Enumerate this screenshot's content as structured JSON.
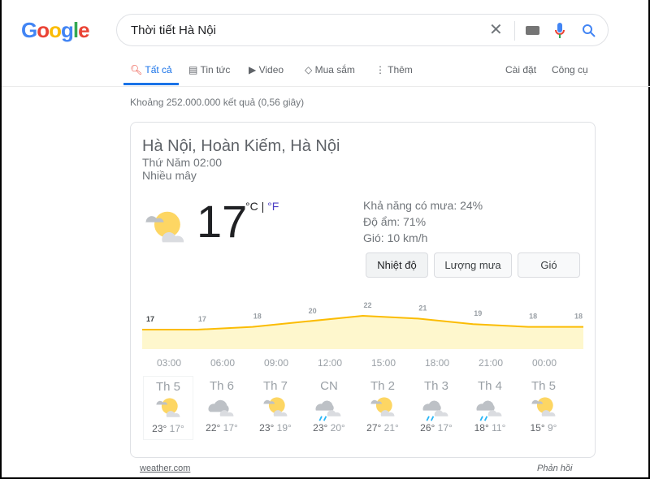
{
  "logo": "Google",
  "search": {
    "query": "Thời tiết Hà Nội"
  },
  "tabs": [
    {
      "label": "Tất cả",
      "icon": "search-icon"
    },
    {
      "label": "Tin tức",
      "icon": "news-icon"
    },
    {
      "label": "Video",
      "icon": "video-icon"
    },
    {
      "label": "Mua sắm",
      "icon": "tag-icon"
    },
    {
      "label": "Thêm",
      "icon": "more-icon"
    }
  ],
  "tools": {
    "settings": "Cài đặt",
    "tools": "Công cụ"
  },
  "stats": "Khoảng 252.000.000 kết quả (0,56 giây)",
  "weather": {
    "location": "Hà Nội, Hoàn Kiếm, Hà Nội",
    "time": "Thứ Năm 02:00",
    "condition": "Nhiều mây",
    "temp": "17",
    "unit_c": "°C",
    "sep": " | ",
    "unit_f": "°F",
    "precip": "Khả năng có mưa: 24%",
    "humidity": "Độ ẩm: 71%",
    "wind": "Gió: 10 km/h",
    "buttons": [
      "Nhiệt độ",
      "Lượng mưa",
      "Gió"
    ],
    "accent": "#fbbc04"
  },
  "chart_data": {
    "type": "area",
    "x": [
      "03:00",
      "06:00",
      "09:00",
      "12:00",
      "15:00",
      "18:00",
      "21:00",
      "00:00",
      ""
    ],
    "values": [
      17,
      17,
      18,
      20,
      22,
      21,
      19,
      18,
      18
    ],
    "labels": [
      "17",
      "17",
      "18",
      "20",
      "22",
      "21",
      "19",
      "18",
      "18"
    ]
  },
  "days": [
    {
      "name": "Th 5",
      "icon": "partly-cloudy",
      "hi": "23°",
      "lo": "17°"
    },
    {
      "name": "Th 6",
      "icon": "cloudy",
      "hi": "22°",
      "lo": "17°"
    },
    {
      "name": "Th 7",
      "icon": "partly-cloudy",
      "hi": "23°",
      "lo": "19°"
    },
    {
      "name": "CN",
      "icon": "rain",
      "hi": "23°",
      "lo": "20°"
    },
    {
      "name": "Th 2",
      "icon": "partly-cloudy",
      "hi": "27°",
      "lo": "21°"
    },
    {
      "name": "Th 3",
      "icon": "rain",
      "hi": "26°",
      "lo": "17°"
    },
    {
      "name": "Th 4",
      "icon": "rain",
      "hi": "18°",
      "lo": "11°"
    },
    {
      "name": "Th 5",
      "icon": "partly-cloudy",
      "hi": "15°",
      "lo": "9°"
    }
  ],
  "footer": {
    "source": "weather.com",
    "feedback": "Phản hồi"
  }
}
